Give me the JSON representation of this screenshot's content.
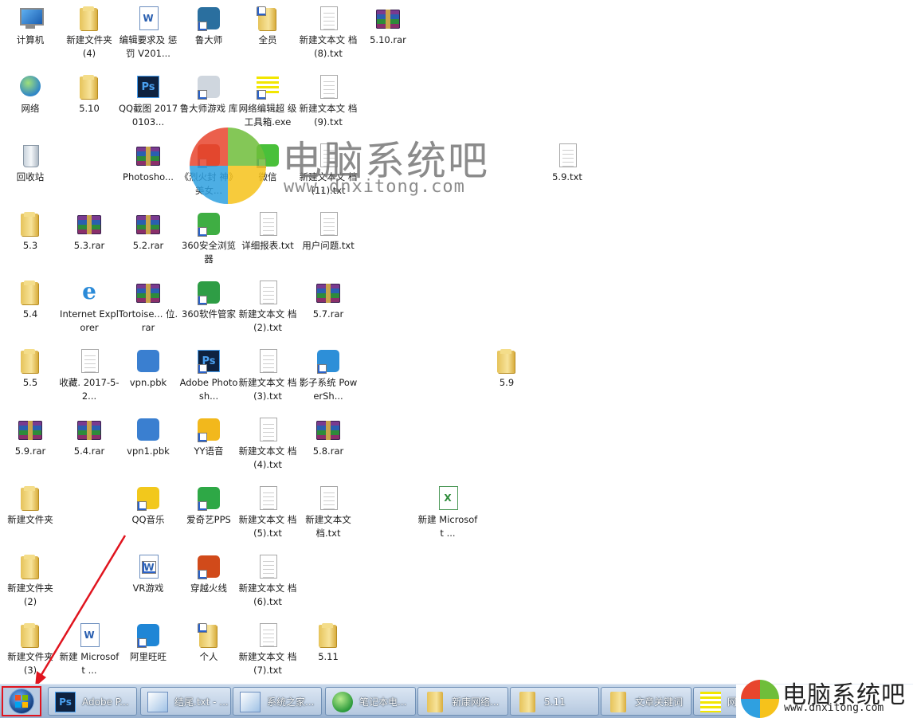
{
  "desktop": {
    "icons": [
      {
        "id": "computer",
        "label": "计算机",
        "icon": "computer-icon"
      },
      {
        "id": "newfolder4",
        "label": "新建文件夹 (4)",
        "icon": "folder-icon"
      },
      {
        "id": "edit_req",
        "label": "编辑要求及 惩罚 V201...",
        "icon": "word-doc-icon"
      },
      {
        "id": "ludashi",
        "label": "鲁大师",
        "icon": "ludashi-icon"
      },
      {
        "id": "quanyuan",
        "label": "全员",
        "icon": "folder-shortcut-icon"
      },
      {
        "id": "txt8",
        "label": "新建文本文 档 (8).txt",
        "icon": "txt-icon"
      },
      {
        "id": "rar510",
        "label": "5.10.rar",
        "icon": "rar-icon"
      },
      {
        "id": "network",
        "label": "网络",
        "icon": "network-icon"
      },
      {
        "id": "f510",
        "label": "5.10",
        "icon": "folder-icon"
      },
      {
        "id": "qq_shot",
        "label": "QQ截图 20170103...",
        "icon": "photoshop-file-icon"
      },
      {
        "id": "lu_game",
        "label": "鲁大师游戏 库",
        "icon": "gamepad-icon"
      },
      {
        "id": "wl_tool",
        "label": "网络编辑超 级工具箱.exe",
        "icon": "notepad-yellow-icon"
      },
      {
        "id": "txt9",
        "label": "新建文本文 档 (9).txt",
        "icon": "txt-icon"
      },
      {
        "id": "recycle",
        "label": "回收站",
        "icon": "recycle-bin-icon"
      },
      {
        "id": "photosho",
        "label": "Photosho...",
        "icon": "rar-icon"
      },
      {
        "id": "liehuo",
        "label": "《烈火封 神》美女...",
        "icon": "game-girl-icon"
      },
      {
        "id": "weixin",
        "label": "微信",
        "icon": "wechat-icon"
      },
      {
        "id": "txt11",
        "label": "新建文本文 档 (11).txt",
        "icon": "txt-icon"
      },
      {
        "id": "txt59",
        "label": "5.9.txt",
        "icon": "txt-icon"
      },
      {
        "id": "f53",
        "label": "5.3",
        "icon": "folder-icon"
      },
      {
        "id": "rar53",
        "label": "5.3.rar",
        "icon": "rar-icon"
      },
      {
        "id": "rar52",
        "label": "5.2.rar",
        "icon": "rar-icon"
      },
      {
        "id": "b360",
        "label": "360安全浏览 器",
        "icon": "browser-360-icon"
      },
      {
        "id": "report",
        "label": "详细报表.txt",
        "icon": "txt-icon"
      },
      {
        "id": "userq",
        "label": "用户问题.txt",
        "icon": "txt-icon"
      },
      {
        "id": "f54",
        "label": "5.4",
        "icon": "folder-icon"
      },
      {
        "id": "ie",
        "label": "Internet Explorer",
        "icon": "ie-icon"
      },
      {
        "id": "tortoise",
        "label": "Tortoise... 位.rar",
        "icon": "rar-icon"
      },
      {
        "id": "soft360",
        "label": "360软件管家",
        "icon": "softmgr-360-icon"
      },
      {
        "id": "txt2",
        "label": "新建文本文 档 (2).txt",
        "icon": "txt-icon"
      },
      {
        "id": "rar57",
        "label": "5.7.rar",
        "icon": "rar-icon"
      },
      {
        "id": "f55",
        "label": "5.5",
        "icon": "folder-icon"
      },
      {
        "id": "shoucang",
        "label": "收藏. 2017-5-2...",
        "icon": "blank-file-icon"
      },
      {
        "id": "vpn",
        "label": "vpn.pbk",
        "icon": "vpn-icon"
      },
      {
        "id": "adobe_ps",
        "label": "Adobe Photosh...",
        "icon": "photoshop-icon"
      },
      {
        "id": "txt3",
        "label": "新建文本文 档 (3).txt",
        "icon": "txt-icon"
      },
      {
        "id": "yingzi",
        "label": "影子系统 PowerSh...",
        "icon": "shadow-system-icon"
      },
      {
        "id": "f59",
        "label": "5.9",
        "icon": "folder-icon"
      },
      {
        "id": "rar59",
        "label": "5.9.rar",
        "icon": "rar-icon"
      },
      {
        "id": "rar54",
        "label": "5.4.rar",
        "icon": "rar-icon"
      },
      {
        "id": "vpn1",
        "label": "vpn1.pbk",
        "icon": "vpn-icon"
      },
      {
        "id": "yy",
        "label": "YY语音",
        "icon": "yy-icon"
      },
      {
        "id": "txt4",
        "label": "新建文本文 档 (4).txt",
        "icon": "txt-icon"
      },
      {
        "id": "rar58",
        "label": "5.8.rar",
        "icon": "rar-icon"
      },
      {
        "id": "newfolder",
        "label": "新建文件夹",
        "icon": "folder-icon"
      },
      {
        "id": "qqmusic",
        "label": "QQ音乐",
        "icon": "qqmusic-icon"
      },
      {
        "id": "iqiyi",
        "label": "爱奇艺PPS",
        "icon": "iqiyi-icon"
      },
      {
        "id": "txt5",
        "label": "新建文本文 档 (5).txt",
        "icon": "txt-icon"
      },
      {
        "id": "txtplain",
        "label": "新建文本文 档.txt",
        "icon": "txt-icon"
      },
      {
        "id": "ms_xls",
        "label": "新建 Microsoft ...",
        "icon": "excel-icon"
      },
      {
        "id": "newfolder2",
        "label": "新建文件夹 (2)",
        "icon": "folder-icon"
      },
      {
        "id": "vrgame",
        "label": "VR游戏",
        "icon": "vr-game-icon"
      },
      {
        "id": "cf",
        "label": "穿越火线",
        "icon": "crossfire-icon"
      },
      {
        "id": "txt6",
        "label": "新建文本文 档 (6).txt",
        "icon": "txt-icon"
      },
      {
        "id": "newfolder3",
        "label": "新建文件夹 (3)",
        "icon": "folder-icon"
      },
      {
        "id": "ms_doc",
        "label": "新建 Microsoft ...",
        "icon": "word-doc-icon"
      },
      {
        "id": "aliww",
        "label": "阿里旺旺",
        "icon": "aliwangwang-icon"
      },
      {
        "id": "geren",
        "label": "个人",
        "icon": "folder-shortcut-icon"
      },
      {
        "id": "txt7",
        "label": "新建文本文 档 (7).txt",
        "icon": "txt-icon"
      },
      {
        "id": "f511",
        "label": "5.11",
        "icon": "folder-icon"
      }
    ]
  },
  "watermark": {
    "title": "电脑系统吧",
    "url": "www.dnxitong.com"
  },
  "taskbar": {
    "start_label": "Start",
    "tasks": [
      {
        "label": "Adobe P...",
        "icon": "photoshop-icon"
      },
      {
        "label": "结尾.txt - ...",
        "icon": "notepad-icon"
      },
      {
        "label": "系统之家...",
        "icon": "notepad-icon"
      },
      {
        "label": "笔记本电...",
        "icon": "browser-360-icon"
      },
      {
        "label": "新康网络...",
        "icon": "folder-icon"
      },
      {
        "label": "5.11",
        "icon": "folder-icon"
      },
      {
        "label": "文章关键词",
        "icon": "folder-icon"
      },
      {
        "label": "网",
        "icon": "notepad-yellow-icon"
      }
    ],
    "logo_title": "电脑系统吧",
    "logo_url": "www.dnxitong.com"
  },
  "colors": {
    "annotation_red": "#e0141e",
    "taskbar": "#a9c0da"
  }
}
